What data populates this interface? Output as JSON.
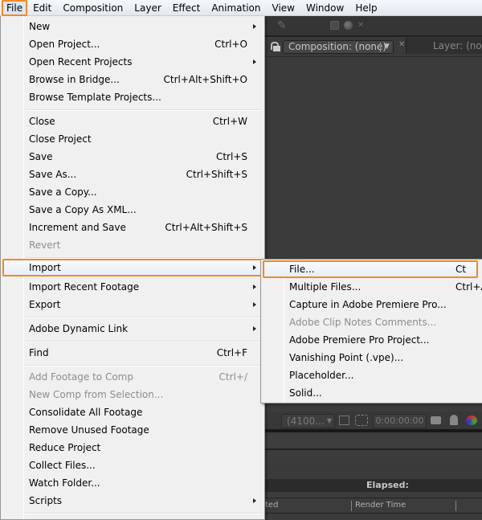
{
  "menubar": {
    "items": [
      "File",
      "Edit",
      "Composition",
      "Layer",
      "Effect",
      "Animation",
      "View",
      "Window",
      "Help"
    ],
    "active": "File"
  },
  "file_menu": {
    "items": [
      {
        "label": "New",
        "shortcut": "",
        "submenu": true,
        "disabled": false
      },
      {
        "label": "Open Project...",
        "shortcut": "Ctrl+O",
        "submenu": false,
        "disabled": false
      },
      {
        "label": "Open Recent Projects",
        "shortcut": "",
        "submenu": true,
        "disabled": false
      },
      {
        "label": "Browse in Bridge...",
        "shortcut": "Ctrl+Alt+Shift+O",
        "submenu": false,
        "disabled": false
      },
      {
        "label": "Browse Template Projects...",
        "shortcut": "",
        "submenu": false,
        "disabled": false
      },
      {
        "label": "Close",
        "shortcut": "Ctrl+W",
        "submenu": false,
        "disabled": false
      },
      {
        "label": "Close Project",
        "shortcut": "",
        "submenu": false,
        "disabled": false
      },
      {
        "label": "Save",
        "shortcut": "Ctrl+S",
        "submenu": false,
        "disabled": false
      },
      {
        "label": "Save As...",
        "shortcut": "Ctrl+Shift+S",
        "submenu": false,
        "disabled": false
      },
      {
        "label": "Save a Copy...",
        "shortcut": "",
        "submenu": false,
        "disabled": false
      },
      {
        "label": "Save a Copy As XML...",
        "shortcut": "",
        "submenu": false,
        "disabled": false
      },
      {
        "label": "Increment and Save",
        "shortcut": "Ctrl+Alt+Shift+S",
        "submenu": false,
        "disabled": false
      },
      {
        "label": "Revert",
        "shortcut": "",
        "submenu": false,
        "disabled": true
      },
      {
        "label": "Import",
        "shortcut": "",
        "submenu": true,
        "disabled": false,
        "highlighted": true
      },
      {
        "label": "Import Recent Footage",
        "shortcut": "",
        "submenu": true,
        "disabled": false
      },
      {
        "label": "Export",
        "shortcut": "",
        "submenu": true,
        "disabled": false
      },
      {
        "label": "Adobe Dynamic Link",
        "shortcut": "",
        "submenu": true,
        "disabled": false
      },
      {
        "label": "Find",
        "shortcut": "Ctrl+F",
        "submenu": false,
        "disabled": false
      },
      {
        "label": "Add Footage to Comp",
        "shortcut": "Ctrl+/",
        "submenu": false,
        "disabled": true
      },
      {
        "label": "New Comp from Selection...",
        "shortcut": "",
        "submenu": false,
        "disabled": true
      },
      {
        "label": "Consolidate All Footage",
        "shortcut": "",
        "submenu": false,
        "disabled": false
      },
      {
        "label": "Remove Unused Footage",
        "shortcut": "",
        "submenu": false,
        "disabled": false
      },
      {
        "label": "Reduce Project",
        "shortcut": "",
        "submenu": false,
        "disabled": false
      },
      {
        "label": "Collect Files...",
        "shortcut": "",
        "submenu": false,
        "disabled": false
      },
      {
        "label": "Watch Folder...",
        "shortcut": "",
        "submenu": false,
        "disabled": false
      },
      {
        "label": "Scripts",
        "shortcut": "",
        "submenu": true,
        "disabled": false
      }
    ]
  },
  "import_submenu": {
    "items": [
      {
        "label": "File...",
        "shortcut": "Ct",
        "disabled": false,
        "highlighted": true
      },
      {
        "label": "Multiple Files...",
        "shortcut": "Ctrl+A",
        "disabled": false
      },
      {
        "label": "Capture in Adobe Premiere Pro...",
        "shortcut": "",
        "disabled": false
      },
      {
        "label": "Adobe Clip Notes Comments...",
        "shortcut": "",
        "disabled": true
      },
      {
        "label": "Adobe Premiere Pro Project...",
        "shortcut": "",
        "disabled": false
      },
      {
        "label": "Vanishing Point (.vpe)...",
        "shortcut": "",
        "disabled": false
      },
      {
        "label": "Placeholder...",
        "shortcut": "",
        "disabled": false
      },
      {
        "label": "Solid...",
        "shortcut": "",
        "disabled": false
      }
    ]
  },
  "app": {
    "composition_tab": "Composition: (none)",
    "layer_tab": "Layer: (none)",
    "resolution": "(4100...",
    "timecode": "0:00:00:00",
    "elapsed_label": "Elapsed:",
    "col_started_partial": "ted",
    "col_render_time": "Render Time"
  },
  "colors": {
    "highlight_outline": "#f08a24",
    "menu_bg": "#f0f0f0",
    "app_bg": "#3c3c3c"
  }
}
